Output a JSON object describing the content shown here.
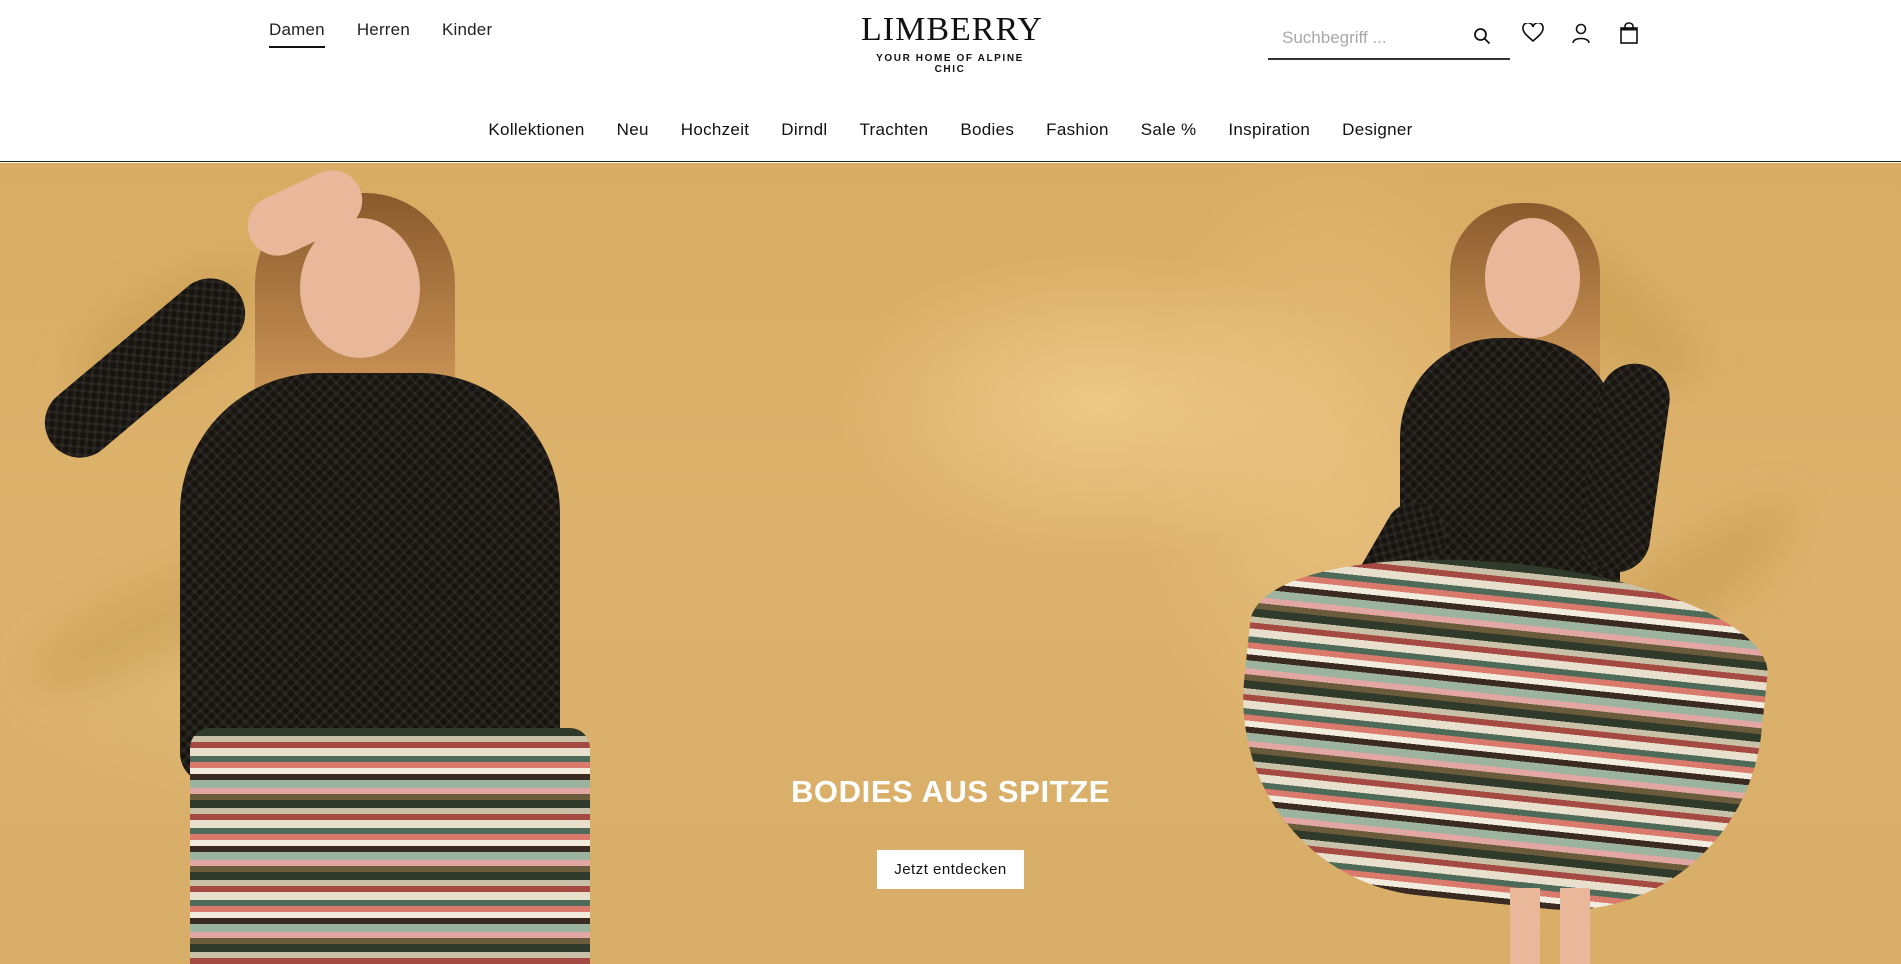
{
  "gender_nav": {
    "items": [
      "Damen",
      "Herren",
      "Kinder"
    ],
    "active": "Damen"
  },
  "logo": {
    "name": "LIMBERRY",
    "tagline": "YOUR HOME OF ALPINE CHIC"
  },
  "search": {
    "placeholder": "Suchbegriff ...",
    "value": ""
  },
  "header_icons": [
    "search-icon",
    "heart-icon",
    "user-icon",
    "shopping-bag-icon"
  ],
  "main_nav": {
    "items": [
      "Kollektionen",
      "Neu",
      "Hochzeit",
      "Dirndl",
      "Trachten",
      "Bodies",
      "Fashion",
      "Sale %",
      "Inspiration",
      "Designer"
    ]
  },
  "hero": {
    "title": "BODIES AUS SPITZE",
    "cta_label": "Jetzt entdecken",
    "background_color": "#d9ac63"
  },
  "colors": {
    "text": "#111111",
    "accent": "#ffffff"
  }
}
